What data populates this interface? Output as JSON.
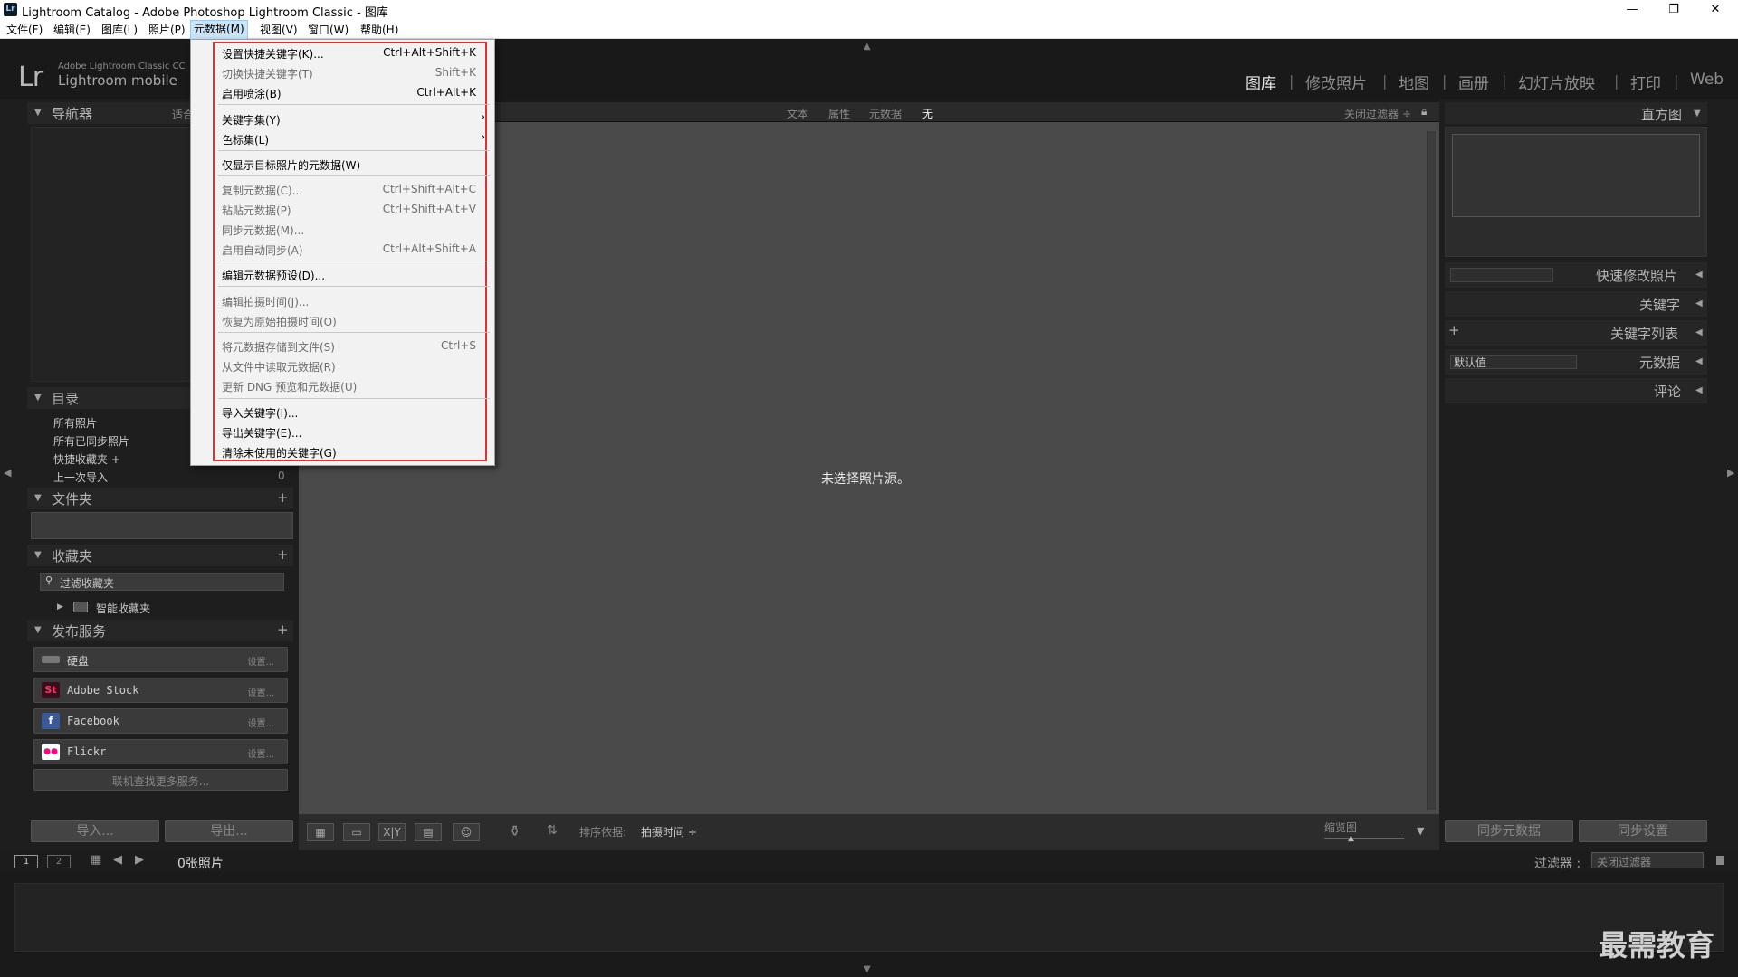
{
  "titlebar": {
    "title": "Lightroom Catalog - Adobe Photoshop Lightroom Classic - 图库",
    "app_icon": "Lr",
    "min": "—",
    "restore": "❐",
    "close": "✕"
  },
  "menubar": {
    "items": [
      "文件(F)",
      "编辑(E)",
      "图库(L)",
      "照片(P)",
      "元数据(M)",
      "视图(V)",
      "窗口(W)",
      "帮助(H)"
    ]
  },
  "brand": {
    "logo": "Lr",
    "line1": "Adobe Lightroom Classic CC",
    "line2": "Lightroom mobile"
  },
  "modules": [
    "图库",
    "修改照片",
    "地图",
    "画册",
    "幻灯片放映",
    "打印",
    "Web"
  ],
  "module_separator": "|",
  "filterbar": {
    "tabs": [
      "文本",
      "属性",
      "元数据",
      "无"
    ],
    "right": "关闭过滤器 ÷"
  },
  "left_panel": {
    "navigator": {
      "title": "导航器",
      "option": "适合"
    },
    "catalog": {
      "title": "目录",
      "items": [
        {
          "label": "所有照片",
          "count": ""
        },
        {
          "label": "所有已同步照片",
          "count": ""
        },
        {
          "label": "快捷收藏夹 +",
          "count": ""
        },
        {
          "label": "上一次导入",
          "count": "0"
        }
      ]
    },
    "folders": {
      "title": "文件夹",
      "add": "+"
    },
    "collections": {
      "title": "收藏夹",
      "add": "+",
      "filter_placeholder": "过滤收藏夹",
      "smart": "智能收藏夹"
    },
    "publish": {
      "title": "发布服务",
      "add": "+",
      "services": [
        {
          "name": "硬盘",
          "setup": "设置..."
        },
        {
          "name": "Adobe Stock",
          "setup": "设置...",
          "icon": "St"
        },
        {
          "name": "Facebook",
          "setup": "设置...",
          "icon": "f"
        },
        {
          "name": "Flickr",
          "setup": "设置...",
          "icon": "●●"
        }
      ],
      "find_more": "联机查找更多服务..."
    },
    "import_btn": "导入...",
    "export_btn": "导出..."
  },
  "right_panel": {
    "histogram": "直方图",
    "quick_develop": "快速修改照片",
    "keywording": "关键字",
    "keyword_list": "关键字列表",
    "keyword_add": "+",
    "metadata": "元数据",
    "metadata_preset": "默认值",
    "comments": "评论",
    "sync_metadata": "同步元数据",
    "sync_settings": "同步设置"
  },
  "center": {
    "message": "未选择照片源。"
  },
  "toolbar": {
    "sort_label": "排序依据:",
    "sort_value": "拍摄时间 ÷",
    "thumb_label": "缩览图",
    "xy": "X|Y"
  },
  "filmbar": {
    "screen1": "1",
    "screen2": "2",
    "count": "0张照片",
    "filter_label": "过滤器 :",
    "filter_value": "关闭过滤器"
  },
  "watermark": "最需教育",
  "dropdown": {
    "items": [
      {
        "label": "设置快捷关键字(K)...",
        "shortcut": "Ctrl+Alt+Shift+K",
        "disabled": false
      },
      {
        "label": "切换快捷关键字(T)",
        "shortcut": "Shift+K",
        "disabled": true
      },
      {
        "label": "启用喷涂(B)",
        "shortcut": "Ctrl+Alt+K",
        "disabled": false
      },
      {
        "label": "关键字集(Y)",
        "shortcut": "",
        "disabled": false
      },
      {
        "label": "色标集(L)",
        "shortcut": "",
        "disabled": false
      },
      {
        "label": "仅显示目标照片的元数据(W)",
        "shortcut": "",
        "disabled": false
      },
      {
        "label": "复制元数据(C)...",
        "shortcut": "Ctrl+Shift+Alt+C",
        "disabled": true
      },
      {
        "label": "粘贴元数据(P)",
        "shortcut": "Ctrl+Shift+Alt+V",
        "disabled": true
      },
      {
        "label": "同步元数据(M)...",
        "shortcut": "",
        "disabled": true
      },
      {
        "label": "启用自动同步(A)",
        "shortcut": "Ctrl+Alt+Shift+A",
        "disabled": true
      },
      {
        "label": "编辑元数据预设(D)...",
        "shortcut": "",
        "disabled": false
      },
      {
        "label": "编辑拍摄时间(J)...",
        "shortcut": "",
        "disabled": true
      },
      {
        "label": "恢复为原始拍摄时间(O)",
        "shortcut": "",
        "disabled": true
      },
      {
        "label": "将元数据存储到文件(S)",
        "shortcut": "Ctrl+S",
        "disabled": true
      },
      {
        "label": "从文件中读取元数据(R)",
        "shortcut": "",
        "disabled": true
      },
      {
        "label": "更新 DNG 预览和元数据(U)",
        "shortcut": "",
        "disabled": true
      },
      {
        "label": "导入关键字(I)...",
        "shortcut": "",
        "disabled": false
      },
      {
        "label": "导出关键字(E)...",
        "shortcut": "",
        "disabled": false
      },
      {
        "label": "清除未使用的关键字(G)",
        "shortcut": "",
        "disabled": false
      }
    ],
    "submenu_arrow": "›"
  },
  "colors": {
    "highlight": "#e03030",
    "menu_active": "#cce4f7"
  }
}
